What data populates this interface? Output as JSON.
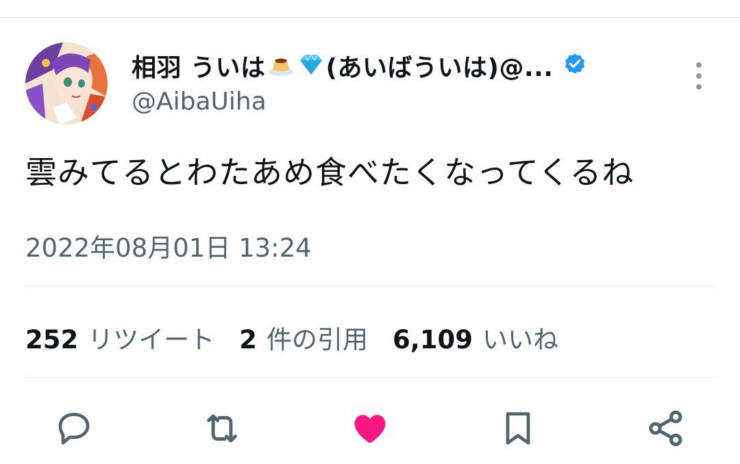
{
  "tweet": {
    "author": {
      "display_name_prefix": "相羽 ういは",
      "display_name_suffix": "(あいばういは)@...",
      "emojis": [
        "pudding-emoji",
        "gem-emoji"
      ],
      "handle": "@AibaUiha",
      "verified": true
    },
    "text": "雲みてるとわたあめ食べたくなってくるね",
    "timestamp": "2022年08月01日 13:24",
    "stats": {
      "retweets_count": "252",
      "retweets_label": "リツイート",
      "quotes_count": "2",
      "quotes_label": "件の引用",
      "likes_count": "6,109",
      "likes_label": "いいね"
    },
    "liked": true
  },
  "actions": {
    "icons": [
      "reply-icon",
      "retweet-icon",
      "like-icon",
      "bookmark-icon",
      "share-icon"
    ]
  },
  "colors": {
    "text_primary": "#0f1419",
    "text_secondary": "#536471",
    "verified_blue": "#1d9bf0",
    "like_pink": "#f91880",
    "divider": "#e6e9ec"
  }
}
